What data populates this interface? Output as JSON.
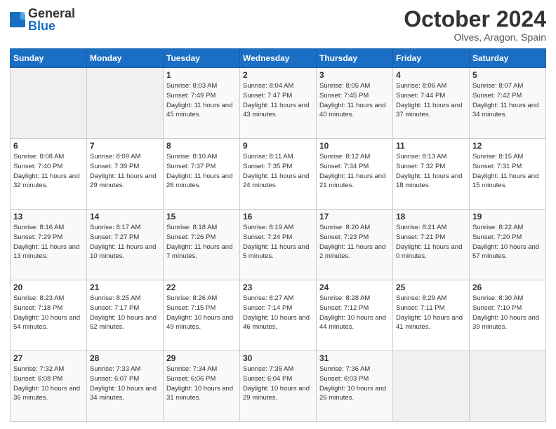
{
  "logo": {
    "text_general": "General",
    "text_blue": "Blue"
  },
  "title": "October 2024",
  "subtitle": "Olves, Aragon, Spain",
  "days_of_week": [
    "Sunday",
    "Monday",
    "Tuesday",
    "Wednesday",
    "Thursday",
    "Friday",
    "Saturday"
  ],
  "weeks": [
    [
      {
        "day": "",
        "info": ""
      },
      {
        "day": "",
        "info": ""
      },
      {
        "day": "1",
        "info": "Sunrise: 8:03 AM\nSunset: 7:49 PM\nDaylight: 11 hours and 45 minutes."
      },
      {
        "day": "2",
        "info": "Sunrise: 8:04 AM\nSunset: 7:47 PM\nDaylight: 11 hours and 43 minutes."
      },
      {
        "day": "3",
        "info": "Sunrise: 8:05 AM\nSunset: 7:45 PM\nDaylight: 11 hours and 40 minutes."
      },
      {
        "day": "4",
        "info": "Sunrise: 8:06 AM\nSunset: 7:44 PM\nDaylight: 11 hours and 37 minutes."
      },
      {
        "day": "5",
        "info": "Sunrise: 8:07 AM\nSunset: 7:42 PM\nDaylight: 11 hours and 34 minutes."
      }
    ],
    [
      {
        "day": "6",
        "info": "Sunrise: 8:08 AM\nSunset: 7:40 PM\nDaylight: 11 hours and 32 minutes."
      },
      {
        "day": "7",
        "info": "Sunrise: 8:09 AM\nSunset: 7:39 PM\nDaylight: 11 hours and 29 minutes."
      },
      {
        "day": "8",
        "info": "Sunrise: 8:10 AM\nSunset: 7:37 PM\nDaylight: 11 hours and 26 minutes."
      },
      {
        "day": "9",
        "info": "Sunrise: 8:11 AM\nSunset: 7:35 PM\nDaylight: 11 hours and 24 minutes."
      },
      {
        "day": "10",
        "info": "Sunrise: 8:12 AM\nSunset: 7:34 PM\nDaylight: 11 hours and 21 minutes."
      },
      {
        "day": "11",
        "info": "Sunrise: 8:13 AM\nSunset: 7:32 PM\nDaylight: 11 hours and 18 minutes."
      },
      {
        "day": "12",
        "info": "Sunrise: 8:15 AM\nSunset: 7:31 PM\nDaylight: 11 hours and 15 minutes."
      }
    ],
    [
      {
        "day": "13",
        "info": "Sunrise: 8:16 AM\nSunset: 7:29 PM\nDaylight: 11 hours and 13 minutes."
      },
      {
        "day": "14",
        "info": "Sunrise: 8:17 AM\nSunset: 7:27 PM\nDaylight: 11 hours and 10 minutes."
      },
      {
        "day": "15",
        "info": "Sunrise: 8:18 AM\nSunset: 7:26 PM\nDaylight: 11 hours and 7 minutes."
      },
      {
        "day": "16",
        "info": "Sunrise: 8:19 AM\nSunset: 7:24 PM\nDaylight: 11 hours and 5 minutes."
      },
      {
        "day": "17",
        "info": "Sunrise: 8:20 AM\nSunset: 7:23 PM\nDaylight: 11 hours and 2 minutes."
      },
      {
        "day": "18",
        "info": "Sunrise: 8:21 AM\nSunset: 7:21 PM\nDaylight: 11 hours and 0 minutes."
      },
      {
        "day": "19",
        "info": "Sunrise: 8:22 AM\nSunset: 7:20 PM\nDaylight: 10 hours and 57 minutes."
      }
    ],
    [
      {
        "day": "20",
        "info": "Sunrise: 8:23 AM\nSunset: 7:18 PM\nDaylight: 10 hours and 54 minutes."
      },
      {
        "day": "21",
        "info": "Sunrise: 8:25 AM\nSunset: 7:17 PM\nDaylight: 10 hours and 52 minutes."
      },
      {
        "day": "22",
        "info": "Sunrise: 8:26 AM\nSunset: 7:15 PM\nDaylight: 10 hours and 49 minutes."
      },
      {
        "day": "23",
        "info": "Sunrise: 8:27 AM\nSunset: 7:14 PM\nDaylight: 10 hours and 46 minutes."
      },
      {
        "day": "24",
        "info": "Sunrise: 8:28 AM\nSunset: 7:12 PM\nDaylight: 10 hours and 44 minutes."
      },
      {
        "day": "25",
        "info": "Sunrise: 8:29 AM\nSunset: 7:11 PM\nDaylight: 10 hours and 41 minutes."
      },
      {
        "day": "26",
        "info": "Sunrise: 8:30 AM\nSunset: 7:10 PM\nDaylight: 10 hours and 39 minutes."
      }
    ],
    [
      {
        "day": "27",
        "info": "Sunrise: 7:32 AM\nSunset: 6:08 PM\nDaylight: 10 hours and 36 minutes."
      },
      {
        "day": "28",
        "info": "Sunrise: 7:33 AM\nSunset: 6:07 PM\nDaylight: 10 hours and 34 minutes."
      },
      {
        "day": "29",
        "info": "Sunrise: 7:34 AM\nSunset: 6:06 PM\nDaylight: 10 hours and 31 minutes."
      },
      {
        "day": "30",
        "info": "Sunrise: 7:35 AM\nSunset: 6:04 PM\nDaylight: 10 hours and 29 minutes."
      },
      {
        "day": "31",
        "info": "Sunrise: 7:36 AM\nSunset: 6:03 PM\nDaylight: 10 hours and 26 minutes."
      },
      {
        "day": "",
        "info": ""
      },
      {
        "day": "",
        "info": ""
      }
    ]
  ]
}
